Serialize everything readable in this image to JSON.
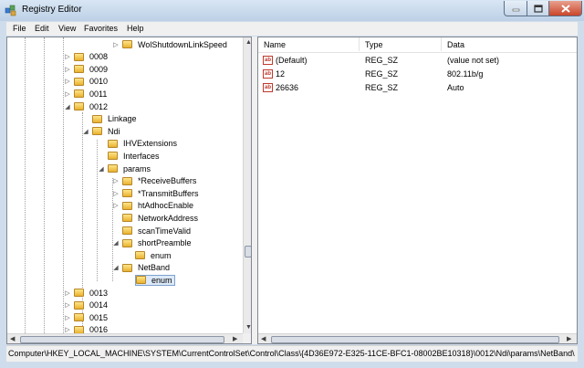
{
  "window": {
    "title": "Registry Editor"
  },
  "menu": [
    "File",
    "Edit",
    "View",
    "Favorites",
    "Help"
  ],
  "tree": [
    {
      "label": "WolShutdownLinkSpeed",
      "expander": "▷",
      "depth": 4
    },
    {
      "label": "0008",
      "expander": "▷",
      "depth": 1
    },
    {
      "label": "0009",
      "expander": "▷",
      "depth": 1
    },
    {
      "label": "0010",
      "expander": "▷",
      "depth": 1
    },
    {
      "label": "0011",
      "expander": "▷",
      "depth": 1
    },
    {
      "label": "0012",
      "expander": "◢",
      "depth": 1
    },
    {
      "label": "Linkage",
      "expander": "",
      "depth": 2
    },
    {
      "label": "Ndi",
      "expander": "◢",
      "depth": 2
    },
    {
      "label": "IHVExtensions",
      "expander": "",
      "depth": 3
    },
    {
      "label": "Interfaces",
      "expander": "",
      "depth": 3
    },
    {
      "label": "params",
      "expander": "◢",
      "depth": 3
    },
    {
      "label": "*ReceiveBuffers",
      "expander": "▷",
      "depth": 4
    },
    {
      "label": "*TransmitBuffers",
      "expander": "▷",
      "depth": 4
    },
    {
      "label": "htAdhocEnable",
      "expander": "▷",
      "depth": 4
    },
    {
      "label": "NetworkAddress",
      "expander": "",
      "depth": 4
    },
    {
      "label": "scanTimeValid",
      "expander": "",
      "depth": 4
    },
    {
      "label": "shortPreamble",
      "expander": "◢",
      "depth": 4
    },
    {
      "label": "enum",
      "expander": "",
      "depth": 5
    },
    {
      "label": "NetBand",
      "expander": "◢",
      "depth": 4
    },
    {
      "label": "enum",
      "expander": "",
      "depth": 5,
      "selected": true
    },
    {
      "label": "0013",
      "expander": "▷",
      "depth": 1
    },
    {
      "label": "0014",
      "expander": "▷",
      "depth": 1
    },
    {
      "label": "0015",
      "expander": "▷",
      "depth": 1
    },
    {
      "label": "0016",
      "expander": "▷",
      "depth": 1
    }
  ],
  "columns": [
    "Name",
    "Type",
    "Data"
  ],
  "values": [
    {
      "name": "(Default)",
      "type": "REG_SZ",
      "data": "(value not set)"
    },
    {
      "name": "12",
      "type": "REG_SZ",
      "data": "802.11b/g"
    },
    {
      "name": "26636",
      "type": "REG_SZ",
      "data": "Auto"
    }
  ],
  "status": {
    "path": "Computer\\HKEY_LOCAL_MACHINE\\SYSTEM\\CurrentControlSet\\Control\\Class\\{4D36E972-E325-11CE-BFC1-08002BE10318}\\0012\\Ndi\\params\\NetBand\\"
  },
  "colors": {
    "accent": "#7da2ce",
    "close": "#c9452a",
    "folder": "#e8b22e"
  },
  "icons": [
    "registry-icon",
    "folder-icon",
    "string-value-icon",
    "minimize-icon",
    "maximize-icon",
    "close-icon"
  ]
}
